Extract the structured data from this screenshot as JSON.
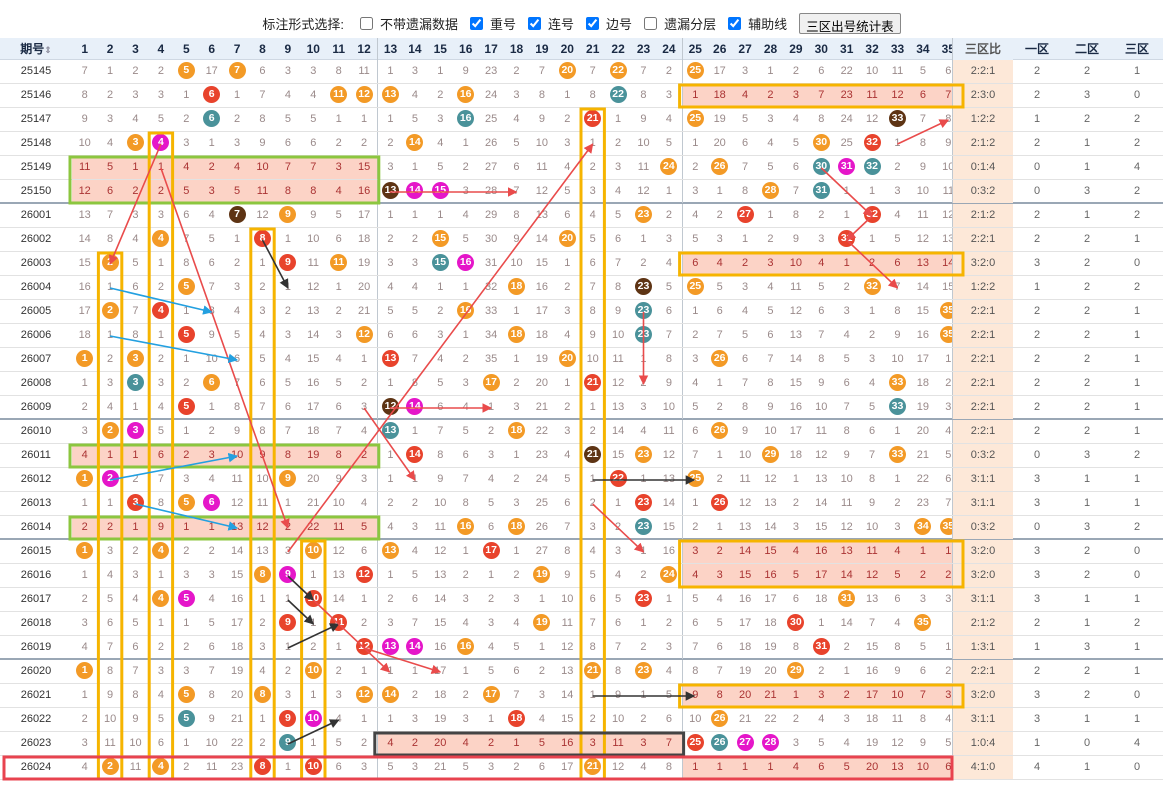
{
  "toolbar": {
    "title": "标注形式选择:",
    "options": [
      {
        "label": "不带遗漏数据",
        "checked": false
      },
      {
        "label": "重号",
        "checked": true
      },
      {
        "label": "连号",
        "checked": true
      },
      {
        "label": "边号",
        "checked": true
      },
      {
        "label": "遗漏分层",
        "checked": false
      },
      {
        "label": "辅助线",
        "checked": true
      }
    ],
    "button": "三区出号统计表"
  },
  "header": {
    "issue": "期号",
    "sort_icon": "⇕",
    "numbers": [
      "1",
      "2",
      "3",
      "4",
      "5",
      "6",
      "7",
      "8",
      "9",
      "10",
      "11",
      "12",
      "13",
      "14",
      "15",
      "16",
      "17",
      "18",
      "19",
      "20",
      "21",
      "22",
      "23",
      "24",
      "25",
      "26",
      "27",
      "28",
      "29",
      "30",
      "31",
      "32",
      "33",
      "34",
      "35"
    ],
    "ratio": "三区比",
    "zones": [
      "一区",
      "二区",
      "三区"
    ]
  },
  "colors": {
    "orange": "#f39a26",
    "red": "#e8432c",
    "teal": "#4a929a",
    "magenta": "#e516c9",
    "brown": "#5e3414",
    "green": "#8cc63f",
    "yellow": "#f6b400",
    "dark": "#333333",
    "blue": "#23a0e0",
    "arrow_red": "#e94b4b"
  },
  "rows": [
    {
      "issue": "25145",
      "cells": [
        "7",
        "1",
        "2",
        "2",
        "o5",
        "17",
        "o7",
        "6",
        "3",
        "3",
        "8",
        "11",
        "1",
        "3",
        "1",
        "9",
        "23",
        "2",
        "7",
        "o20",
        "7",
        "o22",
        "7",
        "2",
        "o25",
        "17",
        "3",
        "1",
        "2",
        "6",
        "22",
        "10",
        "11",
        "5",
        "6"
      ],
      "ratio": "2:2:1",
      "zones": [
        "2",
        "2",
        "1"
      ]
    },
    {
      "issue": "25146",
      "cells": [
        "8",
        "2",
        "3",
        "3",
        "1",
        "r6",
        "1",
        "7",
        "4",
        "4",
        "o11",
        "o12",
        "o13",
        "4",
        "2",
        "o16",
        "24",
        "3",
        "8",
        "1",
        "8",
        "t22",
        "8",
        "3",
        "1",
        "18",
        "4",
        "2",
        "3",
        "7",
        "23",
        "11",
        "12",
        "6",
        "7"
      ],
      "ratio": "2:3:0",
      "zones": [
        "2",
        "3",
        "0"
      ]
    },
    {
      "issue": "25147",
      "cells": [
        "9",
        "3",
        "4",
        "5",
        "2",
        "t6",
        "2",
        "8",
        "5",
        "5",
        "1",
        "1",
        "1",
        "5",
        "3",
        "t16",
        "25",
        "4",
        "9",
        "2",
        "r21",
        "1",
        "9",
        "4",
        "o25",
        "19",
        "5",
        "3",
        "4",
        "8",
        "24",
        "12",
        "k33",
        "7",
        "8"
      ],
      "ratio": "1:2:2",
      "zones": [
        "1",
        "2",
        "2"
      ]
    },
    {
      "issue": "25148",
      "cells": [
        "10",
        "4",
        "o3",
        "m4",
        "3",
        "1",
        "3",
        "9",
        "6",
        "6",
        "2",
        "2",
        "2",
        "o14",
        "4",
        "1",
        "26",
        "5",
        "10",
        "3",
        "1",
        "2",
        "10",
        "5",
        "1",
        "20",
        "6",
        "4",
        "5",
        "o30",
        "25",
        "r32",
        "1",
        "8",
        "9"
      ],
      "ratio": "2:1:2",
      "zones": [
        "2",
        "1",
        "2"
      ]
    },
    {
      "issue": "25149",
      "cells": [
        "11",
        "5",
        "1",
        "1",
        "4",
        "2",
        "4",
        "10",
        "7",
        "7",
        "3",
        "15",
        "3",
        "1",
        "5",
        "2",
        "27",
        "6",
        "11",
        "4",
        "2",
        "3",
        "11",
        "o24",
        "2",
        "o26",
        "7",
        "5",
        "6",
        "t30",
        "m31",
        "t32",
        "2",
        "9",
        "10"
      ],
      "ratio": "0:1:4",
      "zones": [
        "0",
        "1",
        "4"
      ]
    },
    {
      "issue": "25150",
      "cells": [
        "12",
        "6",
        "2",
        "2",
        "5",
        "3",
        "5",
        "11",
        "8",
        "8",
        "4",
        "16",
        "k13",
        "m14",
        "m15",
        "3",
        "28",
        "7",
        "12",
        "5",
        "3",
        "4",
        "12",
        "1",
        "3",
        "1",
        "8",
        "o28",
        "7",
        "t31",
        "1",
        "1",
        "3",
        "10",
        "11"
      ],
      "ratio": "0:3:2",
      "zones": [
        "0",
        "3",
        "2"
      ]
    },
    {
      "issue": "26001",
      "cells": [
        "13",
        "7",
        "3",
        "3",
        "6",
        "4",
        "k7",
        "12",
        "o9",
        "9",
        "5",
        "17",
        "1",
        "1",
        "1",
        "4",
        "29",
        "8",
        "13",
        "6",
        "4",
        "5",
        "o23",
        "2",
        "4",
        "2",
        "r27",
        "1",
        "8",
        "2",
        "1",
        "r32",
        "4",
        "11",
        "12"
      ],
      "ratio": "2:1:2",
      "zones": [
        "2",
        "1",
        "2"
      ]
    },
    {
      "issue": "26002",
      "cells": [
        "14",
        "8",
        "4",
        "o4",
        "7",
        "5",
        "1",
        "r8",
        "1",
        "10",
        "6",
        "18",
        "2",
        "2",
        "o15",
        "5",
        "30",
        "9",
        "14",
        "o20",
        "5",
        "6",
        "1",
        "3",
        "5",
        "3",
        "1",
        "2",
        "9",
        "3",
        "r31",
        "1",
        "5",
        "12",
        "13"
      ],
      "ratio": "2:2:1",
      "zones": [
        "2",
        "2",
        "1"
      ]
    },
    {
      "issue": "26003",
      "cells": [
        "15",
        "o2",
        "5",
        "1",
        "8",
        "6",
        "2",
        "1",
        "r9",
        "11",
        "o11",
        "19",
        "3",
        "3",
        "t15",
        "m16",
        "31",
        "10",
        "15",
        "1",
        "6",
        "7",
        "2",
        "4",
        "6",
        "4",
        "2",
        "3",
        "10",
        "4",
        "1",
        "2",
        "6",
        "13",
        "14"
      ],
      "ratio": "3:2:0",
      "zones": [
        "3",
        "2",
        "0"
      ]
    },
    {
      "issue": "26004",
      "cells": [
        "16",
        "1",
        "6",
        "2",
        "o5",
        "7",
        "3",
        "2",
        "1",
        "12",
        "1",
        "20",
        "4",
        "4",
        "1",
        "1",
        "32",
        "o18",
        "16",
        "2",
        "7",
        "8",
        "k23",
        "5",
        "o25",
        "5",
        "3",
        "4",
        "11",
        "5",
        "2",
        "o32",
        "7",
        "14",
        "15"
      ],
      "ratio": "1:2:2",
      "zones": [
        "1",
        "2",
        "2"
      ]
    },
    {
      "issue": "26005",
      "cells": [
        "17",
        "o2",
        "7",
        "r4",
        "1",
        "8",
        "4",
        "3",
        "2",
        "13",
        "2",
        "21",
        "5",
        "5",
        "2",
        "o16",
        "33",
        "1",
        "17",
        "3",
        "8",
        "9",
        "t23",
        "6",
        "1",
        "6",
        "4",
        "5",
        "12",
        "6",
        "3",
        "1",
        "8",
        "15",
        "o35"
      ],
      "ratio": "2:2:1",
      "zones": [
        "2",
        "2",
        "1"
      ]
    },
    {
      "issue": "26006",
      "cells": [
        "18",
        "1",
        "8",
        "1",
        "r5",
        "9",
        "5",
        "4",
        "3",
        "14",
        "3",
        "o12",
        "6",
        "6",
        "3",
        "1",
        "34",
        "o18",
        "18",
        "4",
        "9",
        "10",
        "t23",
        "7",
        "2",
        "7",
        "5",
        "6",
        "13",
        "7",
        "4",
        "2",
        "9",
        "16",
        "o35"
      ],
      "ratio": "2:2:1",
      "zones": [
        "2",
        "2",
        "1"
      ]
    },
    {
      "issue": "26007",
      "cells": [
        "o1",
        "2",
        "o3",
        "2",
        "1",
        "10",
        "6",
        "5",
        "4",
        "15",
        "4",
        "1",
        "r13",
        "7",
        "4",
        "2",
        "35",
        "1",
        "19",
        "o20",
        "10",
        "11",
        "1",
        "8",
        "3",
        "o26",
        "6",
        "7",
        "14",
        "8",
        "5",
        "3",
        "10",
        "17",
        "1"
      ],
      "ratio": "2:2:1",
      "zones": [
        "2",
        "2",
        "1"
      ]
    },
    {
      "issue": "26008",
      "cells": [
        "1",
        "3",
        "t3",
        "3",
        "2",
        "o6",
        "7",
        "6",
        "5",
        "16",
        "5",
        "2",
        "1",
        "8",
        "5",
        "3",
        "o17",
        "2",
        "20",
        "1",
        "r21",
        "12",
        "2",
        "9",
        "4",
        "1",
        "7",
        "8",
        "15",
        "9",
        "6",
        "4",
        "o33",
        "18",
        "2"
      ],
      "ratio": "2:2:1",
      "zones": [
        "2",
        "2",
        "1"
      ]
    },
    {
      "issue": "26009",
      "cells": [
        "2",
        "4",
        "1",
        "4",
        "r5",
        "1",
        "8",
        "7",
        "6",
        "17",
        "6",
        "3",
        "k12",
        "m14",
        "6",
        "4",
        "1",
        "3",
        "21",
        "2",
        "1",
        "13",
        "3",
        "10",
        "5",
        "2",
        "8",
        "9",
        "16",
        "10",
        "7",
        "5",
        "t33",
        "19",
        "3"
      ],
      "ratio": "2:2:1",
      "zones": [
        "2",
        "2",
        "1"
      ]
    },
    {
      "issue": "26010",
      "cells": [
        "3",
        "o2",
        "m3",
        "5",
        "1",
        "2",
        "9",
        "8",
        "7",
        "18",
        "7",
        "4",
        "t13",
        "1",
        "7",
        "5",
        "2",
        "o18",
        "22",
        "3",
        "2",
        "14",
        "4",
        "11",
        "6",
        "o26",
        "9",
        "10",
        "17",
        "11",
        "8",
        "6",
        "1",
        "20",
        "4"
      ],
      "ratio": "2:2:1",
      "zones": [
        "2",
        "2",
        "1"
      ]
    },
    {
      "issue": "26011",
      "cells": [
        "4",
        "1",
        "1",
        "6",
        "2",
        "3",
        "10",
        "9",
        "8",
        "19",
        "8",
        "2",
        "1",
        "r14",
        "8",
        "6",
        "3",
        "1",
        "23",
        "4",
        "k21",
        "15",
        "o23",
        "12",
        "7",
        "1",
        "10",
        "o29",
        "18",
        "12",
        "9",
        "7",
        "o33",
        "21",
        "5"
      ],
      "ratio": "0:3:2",
      "zones": [
        "0",
        "3",
        "2"
      ]
    },
    {
      "issue": "26012",
      "cells": [
        "o1",
        "m2",
        "2",
        "7",
        "3",
        "4",
        "11",
        "10",
        "o9",
        "20",
        "9",
        "3",
        "1",
        "1",
        "9",
        "7",
        "4",
        "2",
        "24",
        "5",
        "1",
        "r22",
        "1",
        "13",
        "o25",
        "2",
        "11",
        "12",
        "1",
        "13",
        "10",
        "8",
        "1",
        "22",
        "6"
      ],
      "ratio": "3:1:1",
      "zones": [
        "3",
        "1",
        "1"
      ]
    },
    {
      "issue": "26013",
      "cells": [
        "1",
        "1",
        "r3",
        "8",
        "o5",
        "m6",
        "12",
        "11",
        "1",
        "21",
        "10",
        "4",
        "2",
        "2",
        "10",
        "8",
        "5",
        "3",
        "25",
        "6",
        "2",
        "1",
        "r23",
        "14",
        "1",
        "r26",
        "12",
        "13",
        "2",
        "14",
        "11",
        "9",
        "2",
        "23",
        "7"
      ],
      "ratio": "3:1:1",
      "zones": [
        "3",
        "1",
        "1"
      ]
    },
    {
      "issue": "26014",
      "cells": [
        "2",
        "2",
        "1",
        "9",
        "1",
        "1",
        "13",
        "12",
        "2",
        "22",
        "11",
        "5",
        "4",
        "3",
        "11",
        "o16",
        "6",
        "o18",
        "26",
        "7",
        "3",
        "2",
        "t23",
        "15",
        "2",
        "1",
        "13",
        "14",
        "3",
        "15",
        "12",
        "10",
        "3",
        "o34",
        "o35"
      ],
      "ratio": "0:3:2",
      "zones": [
        "0",
        "3",
        "2"
      ]
    },
    {
      "issue": "26015",
      "cells": [
        "o1",
        "3",
        "2",
        "o4",
        "2",
        "2",
        "14",
        "13",
        "3",
        "o10",
        "12",
        "6",
        "o13",
        "4",
        "12",
        "1",
        "r17",
        "1",
        "27",
        "8",
        "4",
        "3",
        "1",
        "16",
        "3",
        "2",
        "14",
        "15",
        "4",
        "16",
        "13",
        "11",
        "4",
        "1",
        "1"
      ],
      "ratio": "3:2:0",
      "zones": [
        "3",
        "2",
        "0"
      ]
    },
    {
      "issue": "26016",
      "cells": [
        "1",
        "4",
        "3",
        "1",
        "3",
        "3",
        "15",
        "o8",
        "m9",
        "1",
        "13",
        "r12",
        "1",
        "5",
        "13",
        "2",
        "1",
        "2",
        "o19",
        "9",
        "5",
        "4",
        "2",
        "o24",
        "4",
        "3",
        "15",
        "16",
        "5",
        "17",
        "14",
        "12",
        "5",
        "2",
        "2"
      ],
      "ratio": "3:2:0",
      "zones": [
        "3",
        "2",
        "0"
      ]
    },
    {
      "issue": "26017",
      "cells": [
        "2",
        "5",
        "4",
        "o4",
        "m5",
        "4",
        "16",
        "1",
        "1",
        "r10",
        "14",
        "1",
        "2",
        "6",
        "14",
        "3",
        "2",
        "3",
        "1",
        "10",
        "6",
        "5",
        "r23",
        "1",
        "5",
        "4",
        "16",
        "17",
        "6",
        "18",
        "o31",
        "13",
        "6",
        "3",
        "3"
      ],
      "ratio": "3:1:1",
      "zones": [
        "3",
        "1",
        "1"
      ]
    },
    {
      "issue": "26018",
      "cells": [
        "3",
        "6",
        "5",
        "1",
        "1",
        "5",
        "17",
        "2",
        "r9",
        "1",
        "r11",
        "2",
        "3",
        "7",
        "15",
        "4",
        "3",
        "4",
        "o19",
        "11",
        "7",
        "6",
        "1",
        "2",
        "6",
        "5",
        "17",
        "18",
        "r30",
        "1",
        "14",
        "7",
        "4",
        "o35"
      ],
      "ratio": "2:1:2",
      "zones": [
        "2",
        "1",
        "2"
      ]
    },
    {
      "issue": "26019",
      "cells": [
        "4",
        "7",
        "6",
        "2",
        "2",
        "6",
        "18",
        "3",
        "1",
        "2",
        "1",
        "r12",
        "m13",
        "m14",
        "16",
        "o16",
        "4",
        "5",
        "1",
        "12",
        "8",
        "7",
        "2",
        "3",
        "7",
        "6",
        "18",
        "19",
        "8",
        "r31",
        "2",
        "15",
        "8",
        "5",
        "1"
      ],
      "ratio": "1:3:1",
      "zones": [
        "1",
        "3",
        "1"
      ]
    },
    {
      "issue": "26020",
      "cells": [
        "o1",
        "8",
        "7",
        "3",
        "3",
        "7",
        "19",
        "4",
        "2",
        "o10",
        "2",
        "1",
        "1",
        "1",
        "17",
        "1",
        "5",
        "6",
        "2",
        "13",
        "o21",
        "8",
        "o23",
        "4",
        "8",
        "7",
        "19",
        "20",
        "o29",
        "2",
        "1",
        "16",
        "9",
        "6",
        "2"
      ],
      "ratio": "2:2:1",
      "zones": [
        "2",
        "2",
        "1"
      ]
    },
    {
      "issue": "26021",
      "cells": [
        "1",
        "9",
        "8",
        "4",
        "o5",
        "8",
        "20",
        "o8",
        "3",
        "1",
        "3",
        "o12",
        "o14",
        "2",
        "18",
        "2",
        "o17",
        "7",
        "3",
        "14",
        "1",
        "9",
        "1",
        "5",
        "9",
        "8",
        "20",
        "21",
        "1",
        "3",
        "2",
        "17",
        "10",
        "7",
        "3"
      ],
      "ratio": "3:2:0",
      "zones": [
        "3",
        "2",
        "0"
      ]
    },
    {
      "issue": "26022",
      "cells": [
        "2",
        "10",
        "9",
        "5",
        "t5",
        "9",
        "21",
        "1",
        "r9",
        "m10",
        "4",
        "1",
        "1",
        "3",
        "19",
        "3",
        "1",
        "r18",
        "4",
        "15",
        "2",
        "10",
        "2",
        "6",
        "10",
        "o26",
        "21",
        "22",
        "2",
        "4",
        "3",
        "18",
        "11",
        "8",
        "4"
      ],
      "ratio": "3:1:1",
      "zones": [
        "3",
        "1",
        "1"
      ]
    },
    {
      "issue": "26023",
      "cells": [
        "3",
        "11",
        "10",
        "6",
        "1",
        "10",
        "22",
        "2",
        "t9",
        "1",
        "5",
        "2",
        "4",
        "2",
        "20",
        "4",
        "2",
        "1",
        "5",
        "16",
        "3",
        "11",
        "3",
        "7",
        "r25",
        "t26",
        "m27",
        "m28",
        "3",
        "5",
        "4",
        "19",
        "12",
        "9",
        "5"
      ],
      "ratio": "1:0:4",
      "zones": [
        "1",
        "0",
        "4"
      ]
    },
    {
      "issue": "26024",
      "cells": [
        "4",
        "o2",
        "11",
        "o4",
        "2",
        "11",
        "23",
        "r8",
        "1",
        "r10",
        "6",
        "3",
        "5",
        "3",
        "21",
        "5",
        "3",
        "2",
        "6",
        "17",
        "o21",
        "12",
        "4",
        "8",
        "1",
        "1",
        "1",
        "1",
        "4",
        "6",
        "5",
        "20",
        "13",
        "10",
        "6"
      ],
      "ratio": "4:1:0",
      "zones": [
        "4",
        "1",
        "0"
      ]
    }
  ]
}
